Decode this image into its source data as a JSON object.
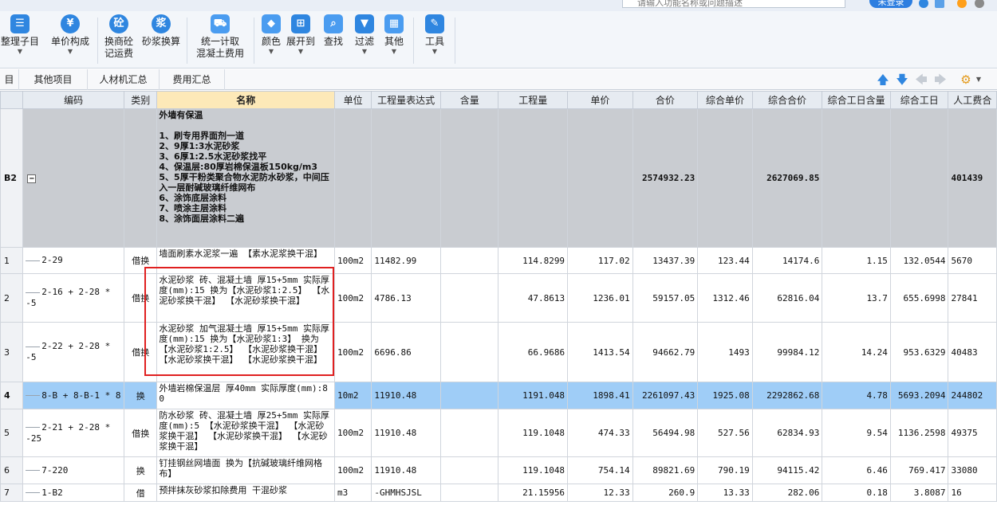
{
  "topbar": {
    "search_placeholder": "请输入功能名称或问题描述",
    "login_label": "未登录"
  },
  "ribbon": {
    "buttons": [
      {
        "label": "整理子目",
        "icon": "organize-icon"
      },
      {
        "label": "单价构成",
        "icon": "price-composition-icon"
      },
      {
        "label": "换商砼\n记运费",
        "icon": "concrete-icon"
      },
      {
        "label": "砂浆换算",
        "icon": "mortar-icon"
      },
      {
        "label": "统一计取\n混凝土费用",
        "icon": "truck-icon"
      },
      {
        "label": "颜色",
        "icon": "color-icon"
      },
      {
        "label": "展开到",
        "icon": "expand-icon"
      },
      {
        "label": "查找",
        "icon": "find-icon"
      },
      {
        "label": "过滤",
        "icon": "filter-icon"
      },
      {
        "label": "其他",
        "icon": "other-icon"
      },
      {
        "label": "工具",
        "icon": "tools-icon"
      }
    ],
    "icon_glyphs": {
      "concrete": "砼",
      "mortar": "浆"
    }
  },
  "tabs": [
    "目",
    "其他项目",
    "人材机汇总",
    "费用汇总"
  ],
  "table": {
    "columns": [
      "编码",
      "类别",
      "名称",
      "单位",
      "工程量表达式",
      "含量",
      "工程量",
      "单价",
      "合价",
      "综合单价",
      "综合合价",
      "综合工日含量",
      "综合工日",
      "人工费合"
    ],
    "header_row": {
      "rownum": "B2",
      "name": "外墙有保温\n\n1、刷专用界面剂一道\n2、9厚1:3水泥砂浆\n3、6厚1:2.5水泥砂浆找平\n4、保温层:80厚岩棉保温板150kg/m3\n5、5厚干粉类聚合物水泥防水砂浆，中间压入一层耐碱玻璃纤维网布\n6、涂饰底层涂料\n7、喷涂主层涂料\n8、涂饰面层涂料二遍",
      "total": "2574932.23",
      "comp_total": "2627069.85",
      "labor": "401439"
    },
    "rows": [
      {
        "num": "1",
        "code": "2-29",
        "type": "借换",
        "name": "墙面刷素水泥浆一遍 【素水泥浆换干混】",
        "unit": "100m2",
        "expr": "11482.99",
        "content": "",
        "qty": "114.8299",
        "price": "117.02",
        "total": "13437.39",
        "comp_price": "123.44",
        "comp_total": "14174.6",
        "wd_content": "1.15",
        "wd": "132.0544",
        "labor": "5670"
      },
      {
        "num": "2",
        "code": "2-16 + 2-28 * -5",
        "type": "借换",
        "name": "水泥砂浆 砖、混凝土墙 厚15+5mm 实际厚度(mm):15 换为【水泥砂浆1:2.5】 【水泥砂浆换干混】 【水泥砂浆换干混】",
        "unit": "100m2",
        "expr": "4786.13",
        "content": "",
        "qty": "47.8613",
        "price": "1236.01",
        "total": "59157.05",
        "comp_price": "1312.46",
        "comp_total": "62816.04",
        "wd_content": "13.7",
        "wd": "655.6998",
        "labor": "27841"
      },
      {
        "num": "3",
        "code": "2-22 + 2-28 * -5",
        "type": "借换",
        "name": "水泥砂浆 加气混凝土墙 厚15+5mm 实际厚度(mm):15 换为【水泥砂浆1:3】 换为【水泥砂浆1:2.5】 【水泥砂浆换干混】 【水泥砂浆换干混】 【水泥砂浆换干混】",
        "unit": "100m2",
        "expr": "6696.86",
        "content": "",
        "qty": "66.9686",
        "price": "1413.54",
        "total": "94662.79",
        "comp_price": "1493",
        "comp_total": "99984.12",
        "wd_content": "14.24",
        "wd": "953.6329",
        "labor": "40483"
      },
      {
        "num": "4",
        "code": "8-B + 8-B-1 * 8",
        "type": "换",
        "name": "外墙岩棉保温层 厚40mm 实际厚度(mm):80",
        "unit": "10m2",
        "expr": "11910.48",
        "content": "",
        "qty": "1191.048",
        "price": "1898.41",
        "total": "2261097.43",
        "comp_price": "1925.08",
        "comp_total": "2292862.68",
        "wd_content": "4.78",
        "wd": "5693.2094",
        "labor": "244802"
      },
      {
        "num": "5",
        "code": "2-21 + 2-28 * -25",
        "type": "借换",
        "name": "防水砂浆 砖、混凝土墙 厚25+5mm 实际厚度(mm):5 【水泥砂浆换干混】 【水泥砂浆换干混】 【水泥砂浆换干混】 【水泥砂浆换干混】",
        "unit": "100m2",
        "expr": "11910.48",
        "content": "",
        "qty": "119.1048",
        "price": "474.33",
        "total": "56494.98",
        "comp_price": "527.56",
        "comp_total": "62834.93",
        "wd_content": "9.54",
        "wd": "1136.2598",
        "labor": "49375"
      },
      {
        "num": "6",
        "code": "7-220",
        "type": "换",
        "name": "钉挂钢丝网墙面 换为【抗碱玻璃纤维网格布】",
        "unit": "100m2",
        "expr": "11910.48",
        "content": "",
        "qty": "119.1048",
        "price": "754.14",
        "total": "89821.69",
        "comp_price": "790.19",
        "comp_total": "94115.42",
        "wd_content": "6.46",
        "wd": "769.417",
        "labor": "33080"
      },
      {
        "num": "7",
        "code": "1-B2",
        "type": "借",
        "name": "预拌抹灰砂浆扣除费用 干混砂浆",
        "unit": "m3",
        "expr": "-GHMHSJSL",
        "content": "",
        "qty": "21.15956",
        "price": "12.33",
        "total": "260.9",
        "comp_price": "13.33",
        "comp_total": "282.06",
        "wd_content": "0.18",
        "wd": "3.8087",
        "labor": "16"
      }
    ]
  }
}
